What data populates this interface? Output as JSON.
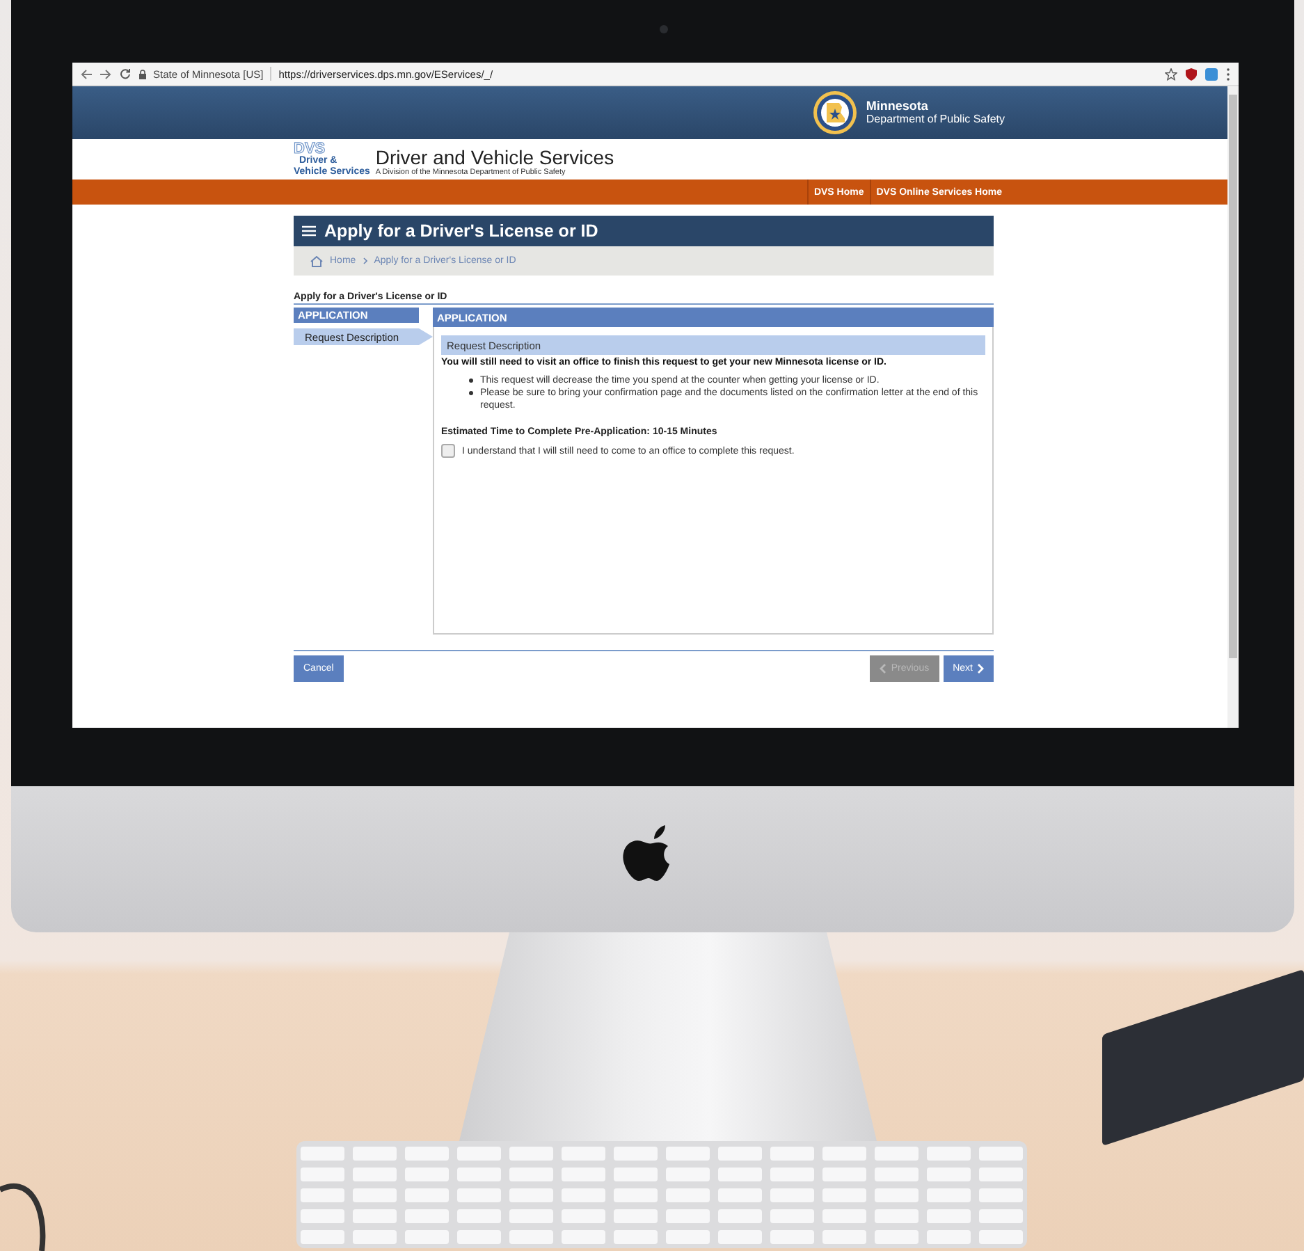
{
  "browser": {
    "site_identity": "State of Minnesota [US]",
    "url": "https://driverservices.dps.mn.gov/EServices/_/"
  },
  "header": {
    "state_name": "Minnesota",
    "department": "Department of Public Safety",
    "logo_letters": "DVS",
    "logo_line_1": "Driver &",
    "logo_line_2": "Vehicle Services",
    "site_title": "Driver and Vehicle Services",
    "site_subtitle": "A Division of the Minnesota Department of Public Safety"
  },
  "nav": [
    "DVS Home",
    "DVS Online Services Home"
  ],
  "page_title": "Apply for a Driver's License or ID",
  "breadcrumb": [
    "Home",
    "Apply for a Driver's License or ID"
  ],
  "form_title": "Apply for a Driver's License or ID",
  "steps": {
    "header": "APPLICATION",
    "items": [
      {
        "label": "Request Description",
        "selected": true
      }
    ]
  },
  "panel": {
    "header": "APPLICATION",
    "section": "Request Description",
    "notice": "You will still need to visit an office to finish this request to get your new Minnesota license or ID.",
    "bullets": [
      "This request will decrease the time you spend at the counter when getting your license or ID.",
      "Please be sure to bring your confirmation page and the documents listed on the confirmation letter at the end of this request."
    ],
    "estimate": "Estimated Time to Complete Pre-Application: 10-15 Minutes",
    "checkbox": {
      "label": "I understand that I will still need to come to an office to complete this request.",
      "checked": false
    }
  },
  "buttons": [
    {
      "kind": "cancel",
      "label": "Cancel",
      "disabled": false
    },
    {
      "kind": "previous",
      "label": "Previous",
      "disabled": true
    },
    {
      "kind": "next",
      "label": "Next",
      "disabled": false
    }
  ]
}
